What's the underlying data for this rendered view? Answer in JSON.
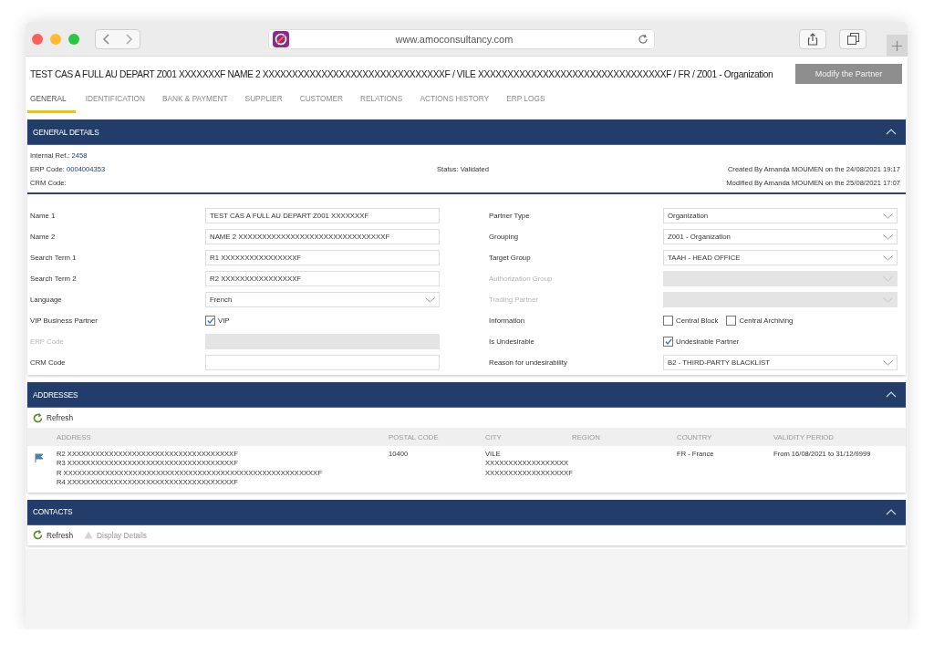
{
  "browser": {
    "url": "www.amoconsultancy.com"
  },
  "title": "TEST CAS A FULL AU DEPART Z001 XXXXXXXF NAME 2 XXXXXXXXXXXXXXXXXXXXXXXXXXXXXXXF / VILE XXXXXXXXXXXXXXXXXXXXXXXXXXXXXXXXF / FR / Z001 - Organization",
  "modify_button": "Modify the Partner",
  "tabs": [
    {
      "label": "GENERAL",
      "selected": true
    },
    {
      "label": "IDENTIFICATION",
      "selected": false
    },
    {
      "label": "BANK & PAYMENT",
      "selected": false
    },
    {
      "label": "SUPPLIER",
      "selected": false
    },
    {
      "label": "CUSTOMER",
      "selected": false
    },
    {
      "label": "RELATIONS",
      "selected": false
    },
    {
      "label": "ACTIONS HISTORY",
      "selected": false
    },
    {
      "label": "ERP LOGS",
      "selected": false
    }
  ],
  "general_details": {
    "title": "GENERAL DETAILS",
    "expanded": true,
    "summary": [
      {
        "label": "Internal Ref.:",
        "value": "2458"
      },
      {
        "label": "ERP Code:",
        "value": "0004004353"
      },
      {
        "label": "CRM Code:"
      }
    ],
    "status": {
      "label": "Status:",
      "value": "Validated"
    },
    "created": "Created By Amanda MOUMEN on the 24/08/2021 19:17",
    "modified": "Modified By Amanda MOUMEN on the 25/08/2021 17:07",
    "fields_left": [
      {
        "label": "Name 1",
        "kind": "text",
        "value": "TEST CAS A FULL AU DEPART Z001 XXXXXXXF",
        "disabled": false
      },
      {
        "label": "Name 2",
        "kind": "text",
        "value": "NAME 2 XXXXXXXXXXXXXXXXXXXXXXXXXXXXXXXF",
        "disabled": false
      },
      {
        "label": "Search Term 1",
        "kind": "text",
        "value": "R1 XXXXXXXXXXXXXXXXF",
        "disabled": false
      },
      {
        "label": "Search Term 2",
        "kind": "text",
        "value": "R2 XXXXXXXXXXXXXXXXF",
        "disabled": false
      },
      {
        "label": "Language",
        "kind": "select",
        "value": "French",
        "disabled": false
      },
      {
        "label": "VIP Business Partner",
        "kind": "checkbox",
        "disabled": false,
        "options": [
          {
            "label": "VIP",
            "checked": true
          }
        ]
      },
      {
        "label": "ERP Code",
        "kind": "text",
        "disabled": true
      },
      {
        "label": "CRM Code",
        "kind": "text",
        "disabled": false
      }
    ],
    "fields_right": [
      {
        "label": "Partner Type",
        "kind": "select",
        "value": "Organization",
        "disabled": false
      },
      {
        "label": "Grouping",
        "kind": "select",
        "value": "Z001 - Organization",
        "disabled": false
      },
      {
        "label": "Target Group",
        "kind": "select",
        "value": "TAAH - HEAD OFFICE",
        "disabled": false
      },
      {
        "label": "Authorization Group",
        "kind": "select",
        "disabled": true
      },
      {
        "label": "Trading Partner",
        "kind": "select",
        "disabled": true
      },
      {
        "label": "Information",
        "kind": "checkbox",
        "disabled": false,
        "options": [
          {
            "label": "Central Block",
            "checked": false
          },
          {
            "label": "Central Archiving",
            "checked": false
          }
        ]
      },
      {
        "label": "Is Undesirable",
        "kind": "checkbox",
        "disabled": false,
        "options": [
          {
            "label": "Undesirable Partner",
            "checked": true
          }
        ]
      },
      {
        "label": "Reason for undesirability",
        "kind": "select",
        "value": "B2 - THIRD-PARTY BLACKLIST",
        "disabled": false
      }
    ]
  },
  "addresses": {
    "title": "ADDRESSES",
    "expanded": true,
    "refresh": "Refresh",
    "columns": [
      "ADDRESS",
      "POSTAL CODE",
      "CITY",
      "REGION",
      "COUNTRY",
      "VALIDITY PERIOD"
    ],
    "rows": [
      {
        "cells": [
          [
            "R2 XXXXXXXXXXXXXXXXXXXXXXXXXXXXXXXXXXXXF",
            "R3 XXXXXXXXXXXXXXXXXXXXXXXXXXXXXXXXXXXXF",
            "R XXXXXXXXXXXXXXXXXXXXXXXXXXXXXXXXXXXXXXXXXXXXXXXXXXXXXXXF",
            "R4 XXXXXXXXXXXXXXXXXXXXXXXXXXXXXXXXXXXXF"
          ],
          [
            "10400"
          ],
          [
            "VILE",
            "XXXXXXXXXXXXXXXXXX",
            "XXXXXXXXXXXXXXXXXXF"
          ],
          null,
          [
            "FR - France"
          ],
          [
            "From 16/08/2021 to 31/12/9999"
          ]
        ]
      }
    ]
  },
  "contacts": {
    "title": "CONTACTS",
    "expanded": true,
    "toolbar": [
      {
        "label": "Refresh",
        "kind": "refresh",
        "disabled": false
      },
      {
        "label": "Display Details",
        "kind": "details",
        "disabled": true
      }
    ]
  }
}
